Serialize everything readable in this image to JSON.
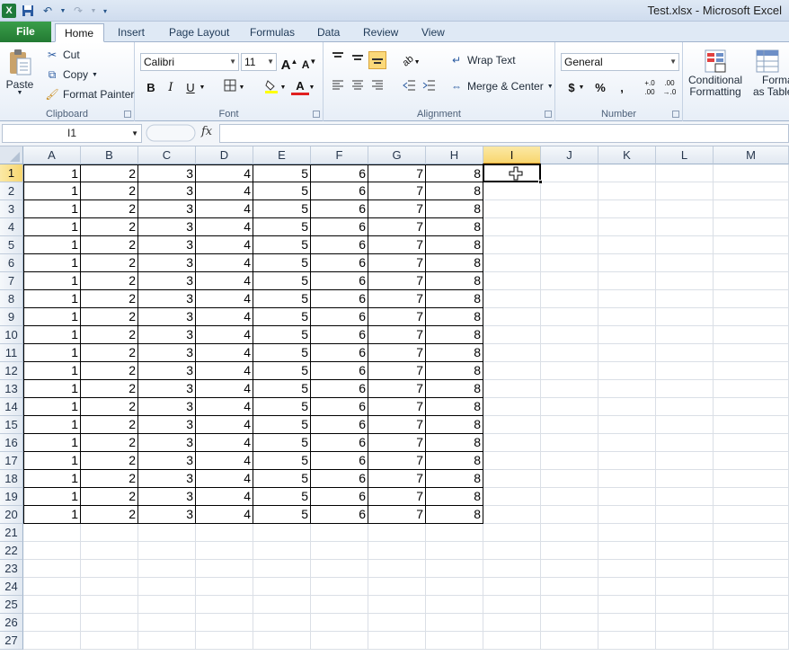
{
  "window": {
    "title": "Test.xlsx - Microsoft Excel"
  },
  "qat": {
    "app_icon": "X",
    "icons": [
      "save-icon",
      "undo-icon",
      "redo-icon",
      "customize-icon"
    ]
  },
  "tabs": [
    {
      "label": "File"
    },
    {
      "label": "Home"
    },
    {
      "label": "Insert"
    },
    {
      "label": "Page Layout"
    },
    {
      "label": "Formulas"
    },
    {
      "label": "Data"
    },
    {
      "label": "Review"
    },
    {
      "label": "View"
    }
  ],
  "clipboard": {
    "paste": "Paste",
    "cut": "Cut",
    "copy": "Copy",
    "format_painter": "Format Painter",
    "label": "Clipboard"
  },
  "font": {
    "name": "Calibri",
    "size": "11",
    "bold": "B",
    "italic": "I",
    "underline": "U",
    "grow": "A",
    "shrink": "A",
    "font_color": "A",
    "label": "Font"
  },
  "alignment": {
    "wrap_text": "Wrap Text",
    "merge_center": "Merge & Center",
    "label": "Alignment"
  },
  "number": {
    "format": "General",
    "currency": "$",
    "percent": "%",
    "comma": ",",
    "inc_decimal": "+.0 .00",
    "dec_decimal": ".00 →.0",
    "label": "Number"
  },
  "styles": {
    "conditional_line1": "Conditional",
    "conditional_line2": "Formatting",
    "format_table_line1": "Format",
    "format_table_line2": "as Table"
  },
  "formula_bar": {
    "name_box": "I1",
    "fx": "fx",
    "value": ""
  },
  "sheet": {
    "columns": [
      "A",
      "B",
      "C",
      "D",
      "E",
      "F",
      "G",
      "H",
      "I",
      "J",
      "K",
      "L",
      "M"
    ],
    "selected_column": "I",
    "selected_row": 1,
    "row_count": 27,
    "data_rows": 20,
    "row_values": [
      "1",
      "2",
      "3",
      "4",
      "5",
      "6",
      "7",
      "8"
    ],
    "colors": {
      "header_selected": "#f8d66f",
      "file_tab": "#2f8c3f"
    }
  }
}
